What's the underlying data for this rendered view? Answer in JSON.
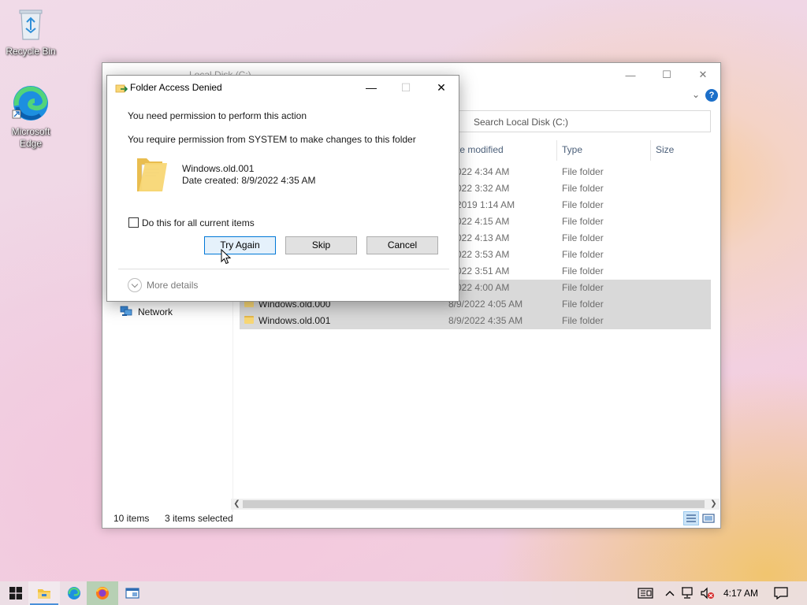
{
  "desktop": {
    "icons": [
      {
        "label": "Recycle Bin",
        "icon": "recycle-bin-icon"
      },
      {
        "label": "Microsoft Edge",
        "icon": "edge-icon"
      }
    ]
  },
  "explorer": {
    "title": "Local Disk (C:)",
    "search_placeholder": "Search Local Disk (C:)",
    "columns": {
      "date": "te modified",
      "type": "Type",
      "size": "Size"
    },
    "rows": [
      {
        "name": "",
        "date": "/2022 4:34 AM",
        "type": "File folder",
        "selected": false
      },
      {
        "name": "",
        "date": "/2022 3:32 AM",
        "type": "File folder",
        "selected": false
      },
      {
        "name": "",
        "date": "7/2019 1:14 AM",
        "type": "File folder",
        "selected": false
      },
      {
        "name": "",
        "date": "/2022 4:15 AM",
        "type": "File folder",
        "selected": false
      },
      {
        "name": "",
        "date": "/2022 4:13 AM",
        "type": "File folder",
        "selected": false
      },
      {
        "name": "",
        "date": "/2022 3:53 AM",
        "type": "File folder",
        "selected": false
      },
      {
        "name": "",
        "date": "/2022 3:51 AM",
        "type": "File folder",
        "selected": false
      },
      {
        "name": "",
        "date": "/2022 4:00 AM",
        "type": "File folder",
        "selected": true
      },
      {
        "name": "Windows.old.000",
        "date": "8/9/2022 4:05 AM",
        "type": "File folder",
        "selected": true
      },
      {
        "name": "Windows.old.001",
        "date": "8/9/2022 4:35 AM",
        "type": "File folder",
        "selected": true
      }
    ],
    "nav": {
      "network": "Network"
    },
    "status": {
      "items": "10 items",
      "selected": "3 items selected"
    }
  },
  "dialog": {
    "title": "Folder Access Denied",
    "message1": "You need permission to perform this action",
    "message2": "You require permission from SYSTEM to make changes to this folder",
    "item_name": "Windows.old.001",
    "item_date": "Date created: 8/9/2022 4:35 AM",
    "checkbox_label": "Do this for all current items",
    "checkbox_checked": false,
    "buttons": {
      "try_again": "Try Again",
      "skip": "Skip",
      "cancel": "Cancel"
    },
    "more_details": "More details"
  },
  "taskbar": {
    "clock": "4:17 AM",
    "apps": [
      "start-icon",
      "file-explorer-icon",
      "edge-icon",
      "firefox-icon",
      "window-app-icon"
    ]
  }
}
